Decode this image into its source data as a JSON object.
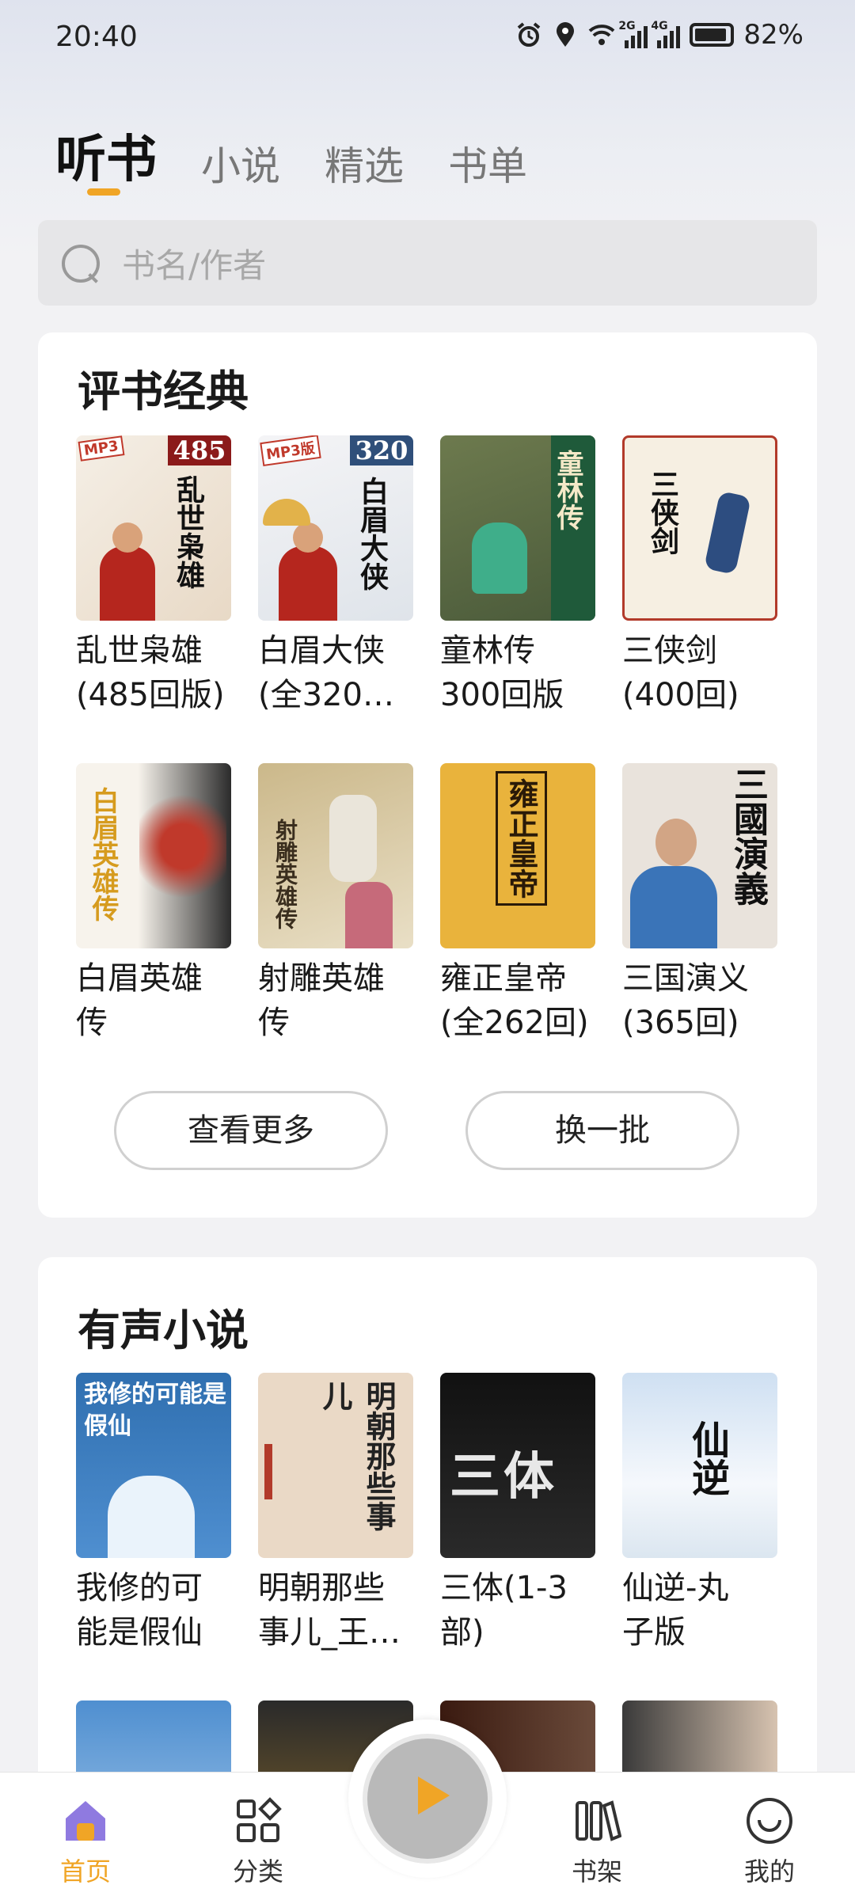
{
  "status_bar": {
    "time": "20:40",
    "battery": "82%",
    "network_labels": [
      "2G",
      "4G"
    ]
  },
  "tabs": [
    {
      "label": "听书",
      "active": true
    },
    {
      "label": "小说",
      "active": false
    },
    {
      "label": "精选",
      "active": false
    },
    {
      "label": "书单",
      "active": false
    }
  ],
  "search": {
    "placeholder": "书名/作者"
  },
  "section1": {
    "title": "评书经典",
    "books": [
      {
        "line1": "乱世枭雄",
        "line2": "(485回版)",
        "cover_text": "乱世枭雄",
        "badge": "485",
        "mp3": "MP3"
      },
      {
        "line1": "白眉大侠",
        "line2": "(全320…",
        "cover_text": "白眉大侠",
        "badge": "320",
        "mp3": "MP3版"
      },
      {
        "line1": "童林传",
        "line2": "300回版",
        "cover_text": "童林传"
      },
      {
        "line1": "三侠剑",
        "line2": "(400回)",
        "cover_text": "三侠剑"
      },
      {
        "line1": "白眉英雄",
        "line2": "传",
        "cover_text": "白眉英雄传"
      },
      {
        "line1": "射雕英雄",
        "line2": "传",
        "cover_text": "射雕英雄传"
      },
      {
        "line1": "雍正皇帝",
        "line2": "(全262回)",
        "cover_text": "雍正皇帝"
      },
      {
        "line1": "三国演义",
        "line2": "(365回)",
        "cover_text": "三國演義"
      }
    ],
    "more_button": "查看更多",
    "refresh_button": "换一批"
  },
  "section2": {
    "title": "有声小说",
    "books": [
      {
        "line1": "我修的可",
        "line2": "能是假仙",
        "cover_text": "我修的可能是假仙"
      },
      {
        "line1": "明朝那些",
        "line2": "事儿_王…",
        "cover_text": "明朝那些事儿"
      },
      {
        "line1": "三体(1-3",
        "line2": "部)",
        "cover_text": "三体"
      },
      {
        "line1": "仙逆-丸",
        "line2": "子版",
        "cover_text": "仙逆"
      }
    ]
  },
  "bottom_nav": [
    {
      "label": "首页",
      "icon": "home-icon",
      "active": true
    },
    {
      "label": "分类",
      "icon": "category-icon",
      "active": false
    },
    {
      "label": "书架",
      "icon": "bookshelf-icon",
      "active": false
    },
    {
      "label": "我的",
      "icon": "profile-icon",
      "active": false
    }
  ],
  "colors": {
    "accent": "#f0a526",
    "background": "#f2f2f4",
    "card": "#ffffff"
  }
}
